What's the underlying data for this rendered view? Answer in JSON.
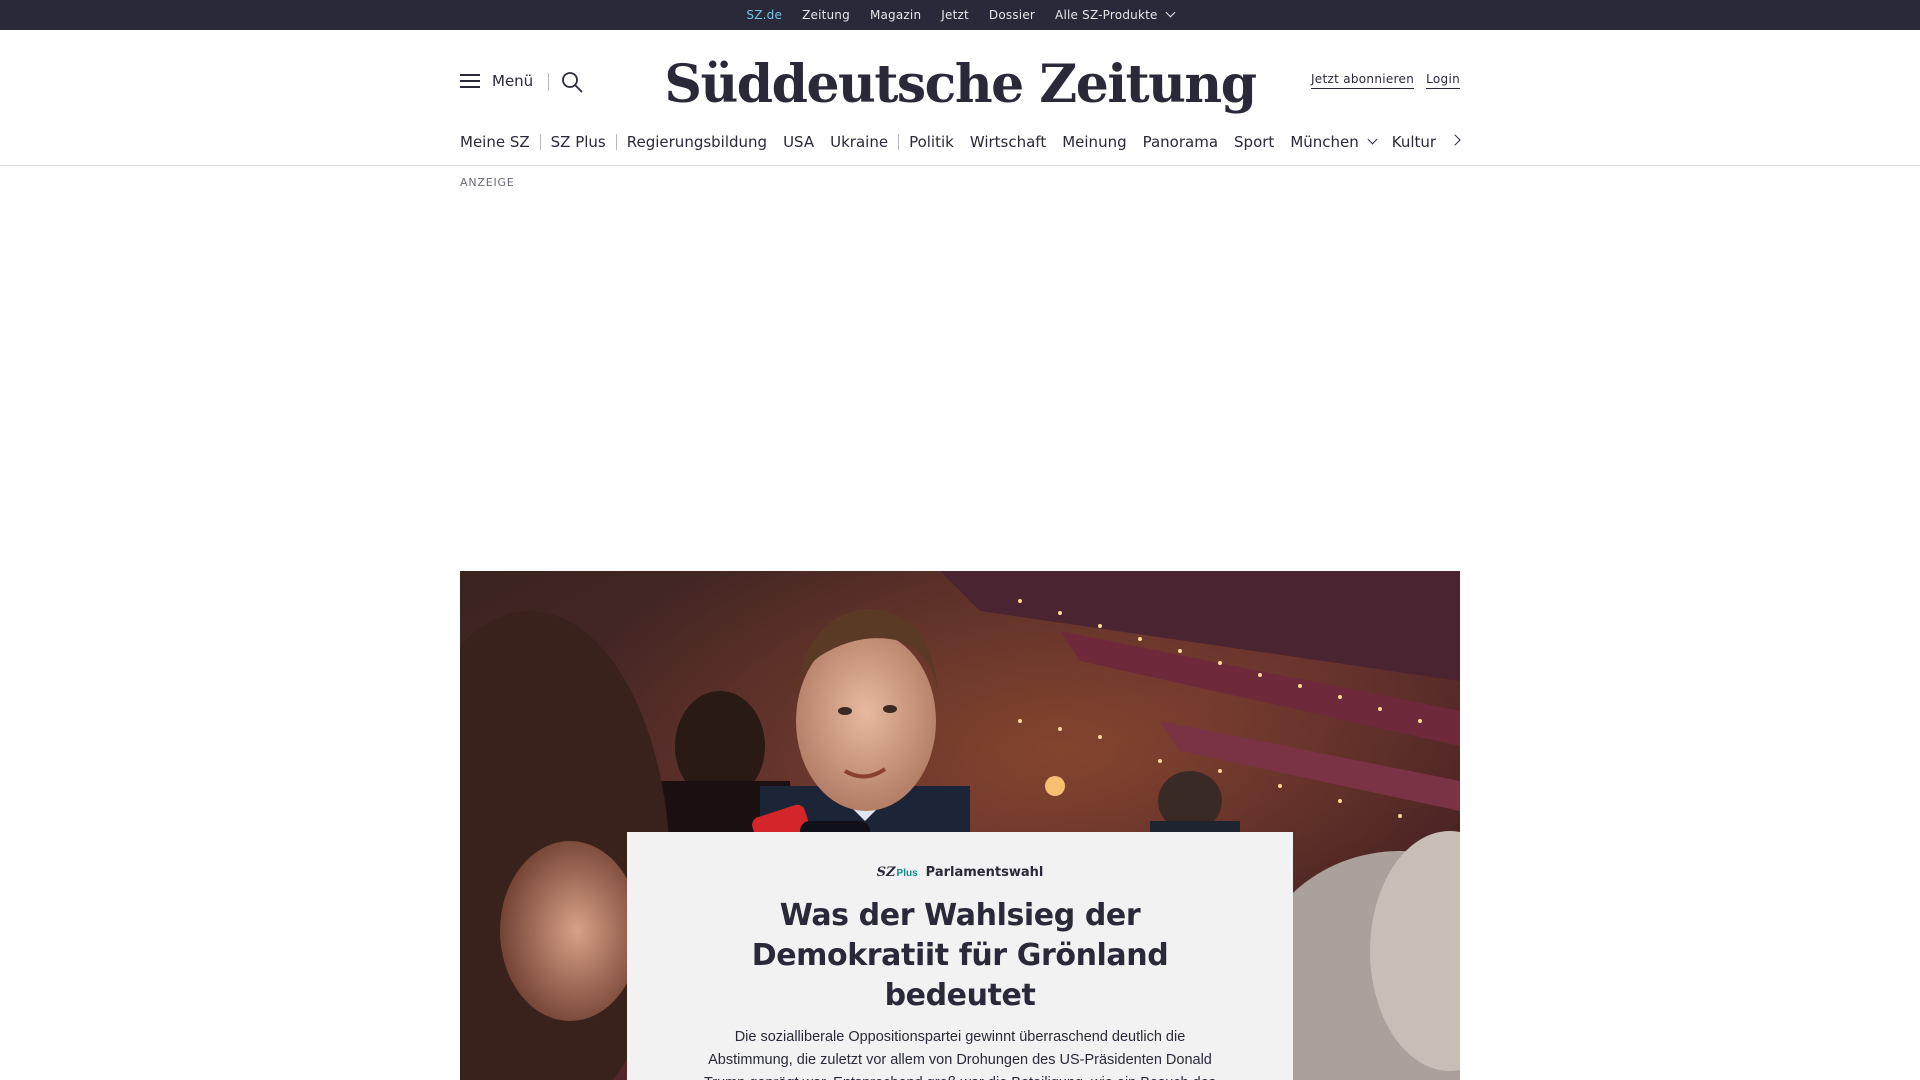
{
  "topbar": {
    "links": [
      {
        "label": "SZ.de",
        "active": true
      },
      {
        "label": "Zeitung"
      },
      {
        "label": "Magazin"
      },
      {
        "label": "Jetzt"
      },
      {
        "label": "Dossier"
      },
      {
        "label": "Alle SZ-Produkte",
        "has_dropdown": true
      }
    ]
  },
  "header": {
    "menu_label": "Menü",
    "logo_text": "Süddeutsche Zeitung",
    "subscribe_label": "Jetzt abonnieren",
    "login_label": "Login"
  },
  "nav": {
    "items": [
      {
        "label": "Meine SZ"
      },
      {
        "label": "SZ Plus"
      },
      {
        "label": "Regierungsbildung"
      },
      {
        "label": "USA"
      },
      {
        "label": "Ukraine"
      },
      {
        "label": "Politik"
      },
      {
        "label": "Wirtschaft"
      },
      {
        "label": "Meinung"
      },
      {
        "label": "Panorama"
      },
      {
        "label": "Sport"
      },
      {
        "label": "München",
        "has_dropdown": true
      },
      {
        "label": "Kultur"
      }
    ]
  },
  "ad": {
    "label": "ANZEIGE"
  },
  "teaser": {
    "badge_sz": "SZ",
    "badge_plus": "Plus",
    "kicker": "Parlamentswahl",
    "headline": "Was der Wahlsieg der Demokratiit für Grönland bedeutet",
    "summary": "Die sozialliberale Oppositionspartei gewinnt überraschend deutlich die Abstimmung, die zuletzt vor allem von Drohungen des US-Präsidenten Donald Trump geprägt war. Entsprechend groß war die Beteiligung, wie ein Besuch des einzigen Wahllokals in Nuuk zeigt."
  },
  "colors": {
    "topbar_bg": "#29293a",
    "active_link": "#71c5e8",
    "text": "#29293a",
    "teaser_bg": "#f2f2f2",
    "plus_accent": "#118a8a"
  }
}
